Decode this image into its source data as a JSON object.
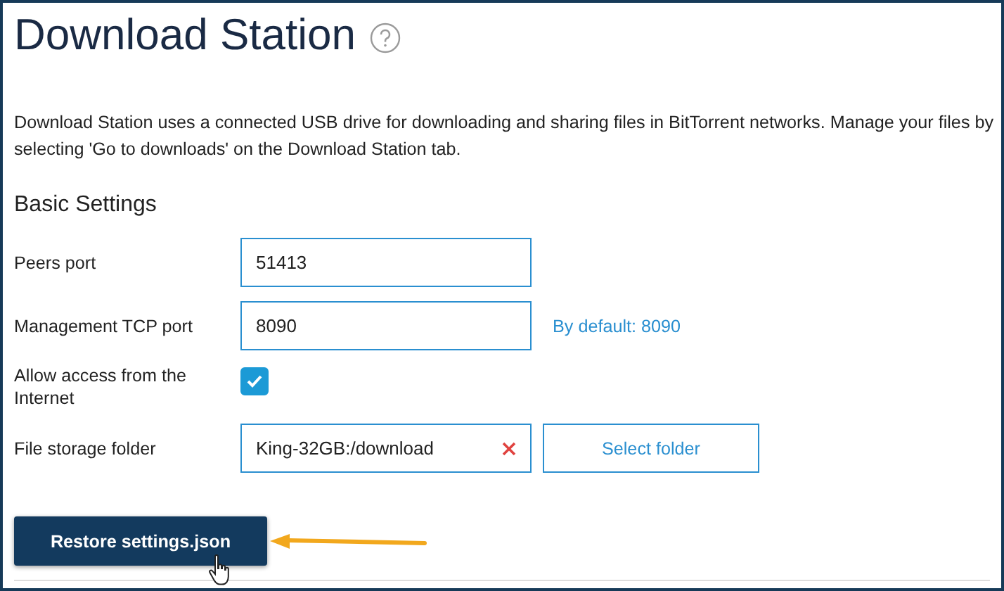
{
  "title": "Download Station",
  "description": "Download Station uses a connected USB drive for downloading and sharing files in BitTorrent networks. Manage your files by selecting 'Go to downloads' on the Download Station tab.",
  "section": "Basic Settings",
  "fields": [
    {
      "kind": "text",
      "label": "Peers port",
      "value": "51413"
    },
    {
      "kind": "text",
      "label": "Management TCP port",
      "value": "8090",
      "hint": "By default: 8090"
    },
    {
      "kind": "checkbox",
      "label": "Allow access from the Internet",
      "checked": true
    },
    {
      "kind": "folder",
      "label": "File storage folder",
      "value": "King-32GB:/download",
      "button": "Select folder"
    }
  ],
  "restore_button": "Restore settings.json"
}
